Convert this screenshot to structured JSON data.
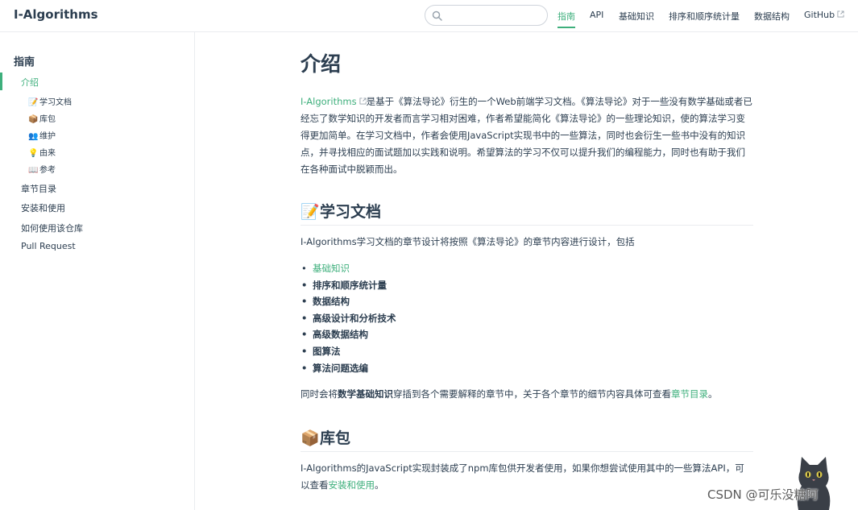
{
  "navbar": {
    "site_name": "I-Algorithms",
    "search": {
      "value": "",
      "placeholder": ""
    },
    "links": [
      {
        "label": "指南",
        "active": true
      },
      {
        "label": "API"
      },
      {
        "label": "基础知识"
      },
      {
        "label": "排序和顺序统计量"
      },
      {
        "label": "数据结构"
      },
      {
        "label": "GitHub",
        "external": true
      }
    ]
  },
  "sidebar": {
    "heading": "指南",
    "items": [
      {
        "label": "介绍",
        "active": true
      },
      {
        "label": "章节目录"
      },
      {
        "label": "安装和使用"
      },
      {
        "label": "如何使用该仓库"
      },
      {
        "label": "Pull Request"
      }
    ],
    "subitems": [
      {
        "emoji": "📝",
        "label": "学习文档"
      },
      {
        "emoji": "📦",
        "label": "库包"
      },
      {
        "emoji": "👥",
        "label": "维护"
      },
      {
        "emoji": "💡",
        "label": "由来"
      },
      {
        "emoji": "📖",
        "label": "参考"
      }
    ]
  },
  "main": {
    "title": "介绍",
    "intro": {
      "link": "I-Algorithms",
      "text": "是基于《算法导论》衍生的一个Web前端学习文档。《算法导论》对于一些没有数学基础或者已经忘了数学知识的开发者而言学习相对困难，作者希望能简化《算法导论》的一些理论知识，使的算法学习变得更加简单。在学习文档中，作者会使用JavaScript实现书中的一些算法，同时也会衍生一些书中没有的知识点，并寻找相应的面试题加以实践和说明。希望算法的学习不仅可以提升我们的编程能力，同时也有助于我们在各种面试中脱颖而出。"
    },
    "section1": {
      "emoji": "📝",
      "title": "学习文档",
      "lead": "I-Algorithms学习文档的章节设计将按照《算法导论》的章节内容进行设计，包括",
      "list": [
        "基础知识",
        "排序和顺序统计量",
        "数据结构",
        "高级设计和分析技术",
        "高级数据结构",
        "图算法",
        "算法问题选编"
      ],
      "note_prefix": "同时会将",
      "note_bold": "数学基础知识",
      "note_middle": "穿插到各个需要解释的章节中，关于各个章节的细节内容具体可查看",
      "note_link": "章节目录",
      "note_suffix": "。"
    },
    "section2": {
      "emoji": "📦",
      "title": "库包",
      "text": "I-Algorithms的JavaScript实现封装成了npm库包供开发者使用，如果你想尝试使用其中的一些算法API，可以查看",
      "link": "安装和使用",
      "suffix": "。"
    }
  },
  "watermark": "CSDN @可乐没糖阿",
  "colors": {
    "accent": "#3eaf7c",
    "text": "#2c3e50",
    "border": "#eaecef"
  }
}
